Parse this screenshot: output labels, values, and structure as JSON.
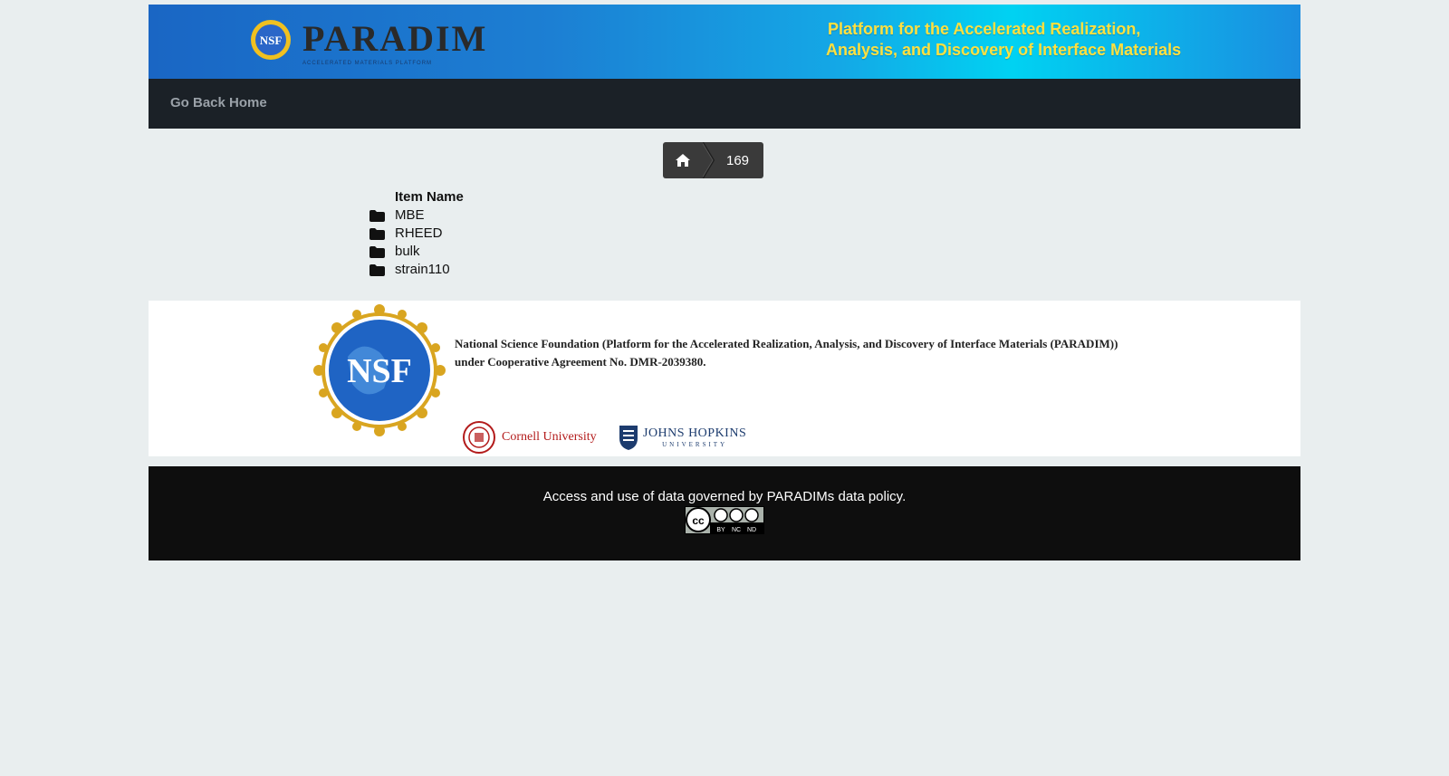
{
  "banner": {
    "logo_text": "PARADIM",
    "logo_sub": "ACCELERATED MATERIALS PLATFORM",
    "nsf_logo": "NSF",
    "tagline_line1": "Platform for the Accelerated Realization,",
    "tagline_line2": "Analysis, and Discovery of Interface Materials"
  },
  "nav": {
    "home_link": "Go Back Home"
  },
  "breadcrumb": {
    "home_icon": "home-icon",
    "current": "169"
  },
  "listing": {
    "header": "Item Name",
    "items": [
      {
        "icon": "folder-icon",
        "label": "MBE"
      },
      {
        "icon": "folder-icon",
        "label": "RHEED"
      },
      {
        "icon": "folder-icon",
        "label": "bulk"
      },
      {
        "icon": "folder-icon",
        "label": "strain110"
      }
    ]
  },
  "funding": {
    "nsf_seal": "NSF",
    "line1": "National Science Foundation (Platform for the Accelerated Realization, Analysis, and Discovery of Interface Materials (PARADIM))",
    "line2": "under Cooperative Agreement No. DMR-2039380.",
    "cornell": "Cornell University",
    "jhu_line1": "JOHNS HOPKINS",
    "jhu_line2": "UNIVERSITY"
  },
  "footer": {
    "policy_text": "Access and use of data governed by PARADIMs data policy.",
    "license_badge": "cc-by-nc-nd-badge"
  },
  "colors": {
    "navbar": "#1b2127",
    "breadcrumb": "#3a3a3a",
    "footer": "#0e0e0e",
    "tagline": "#ffe040"
  }
}
